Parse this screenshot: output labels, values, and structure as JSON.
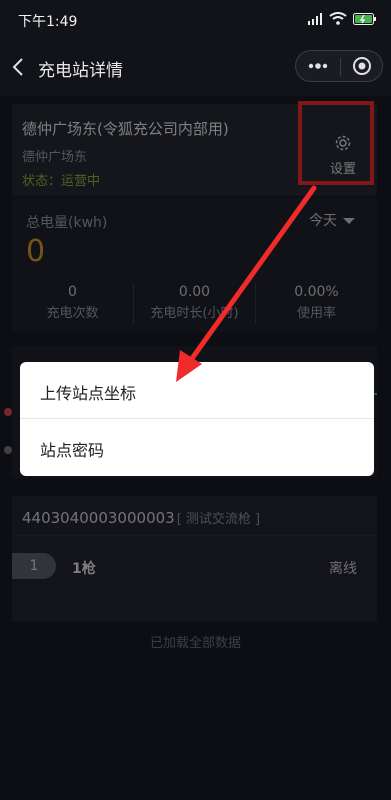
{
  "status_bar": {
    "time": "下午1:49"
  },
  "nav": {
    "title": "充电站详情"
  },
  "station": {
    "name": "德仲广场东(令狐充公司内部用)",
    "address": "德仲广场东",
    "status": "状态：运营中",
    "settings_label": "设置"
  },
  "summary": {
    "energy_label": "总电量(kwh)",
    "energy_value": "0",
    "period": "今天",
    "stats": [
      {
        "value": "0",
        "label": "充电次数"
      },
      {
        "value": "0.00",
        "label": "充电时长(小时)"
      },
      {
        "value": "0.00%",
        "label": "使用率"
      }
    ]
  },
  "gun": {
    "code": "4403040003000003",
    "tag": "[ 测试交流枪 ]",
    "index": "1",
    "name": "1枪",
    "state": "离线"
  },
  "footer": {
    "note": "已加载全部数据"
  },
  "menu": {
    "items": [
      {
        "label": "上传站点坐标"
      },
      {
        "label": "站点密码"
      }
    ]
  },
  "colors": {
    "accent_amber": "#d39a2a",
    "status_green": "#8bb53f",
    "highlight_red": "#ef2b2b"
  }
}
